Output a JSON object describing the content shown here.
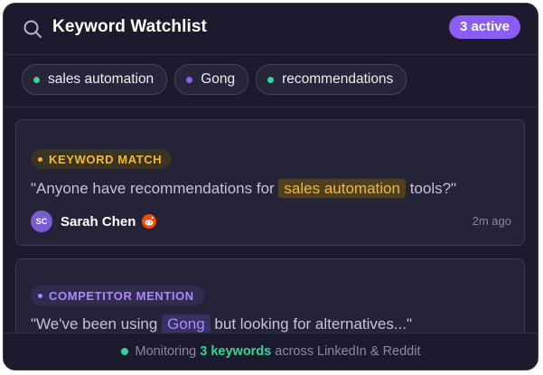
{
  "header": {
    "title": "Keyword Watchlist",
    "active_badge": "3 active"
  },
  "chips": [
    {
      "label": "sales automation",
      "dot_color": "#34d399"
    },
    {
      "label": "Gong",
      "dot_color": "#8b5cf6"
    },
    {
      "label": "recommendations",
      "dot_color": "#34d399"
    }
  ],
  "cards": [
    {
      "tag": "KEYWORD MATCH",
      "quote_before": "\"Anyone have recommendations for",
      "highlight": "sales automation",
      "quote_after": "tools?\"",
      "author_initials": "SC",
      "author_name": "Sarah Chen",
      "source_icon": "reddit-icon",
      "time": "2m ago"
    },
    {
      "tag": "COMPETITOR MENTION",
      "quote_before": "\"We've been using",
      "highlight": "Gong",
      "quote_after": "but looking for alternatives...\""
    }
  ],
  "footer": {
    "prefix": "Monitoring",
    "count": "3 keywords",
    "suffix": "across LinkedIn & Reddit"
  },
  "colors": {
    "accent_purple": "#8b5cf6",
    "accent_green": "#34d399",
    "accent_amber": "#f5b731",
    "panel_bg": "#1c1b2e"
  }
}
